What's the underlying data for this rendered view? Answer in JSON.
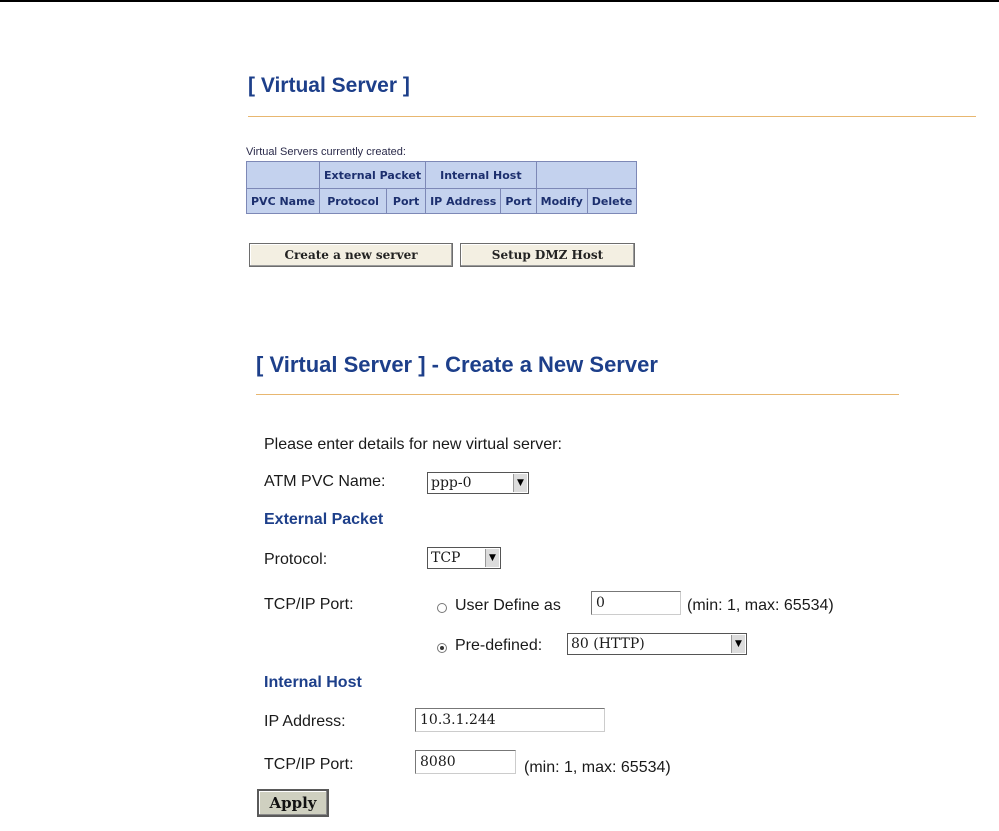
{
  "list": {
    "title": "[ Virtual Server ]",
    "caption": "Virtual Servers currently created:",
    "groups": [
      "External Packet",
      "Internal Host"
    ],
    "columns": [
      "PVC Name",
      "Protocol",
      "Port",
      "IP Address",
      "Port",
      "Modify",
      "Delete"
    ],
    "create_label": "Create a new server",
    "dmz_label": "Setup DMZ Host"
  },
  "form": {
    "title": "[ Virtual Server ] - Create a New Server",
    "intro": "Please enter details for new virtual server:",
    "pvc_label": "ATM PVC Name:",
    "pvc_value": "ppp-0",
    "external_heading": "External Packet",
    "protocol_label": "Protocol:",
    "protocol_value": "TCP",
    "port_label": "TCP/IP Port:",
    "user_define_label": "User Define as",
    "user_define_value": "0",
    "range_text": "(min: 1, max: 65534)",
    "predefined_label": "Pre-defined:",
    "predefined_value": "80 (HTTP)",
    "internal_heading": "Internal Host",
    "ip_label": "IP Address:",
    "ip_value": "10.3.1.244",
    "internal_port_label": "TCP/IP Port:",
    "internal_port_value": "8080",
    "internal_range_text": "(min: 1, max: 65534)",
    "apply_label": "Apply"
  }
}
